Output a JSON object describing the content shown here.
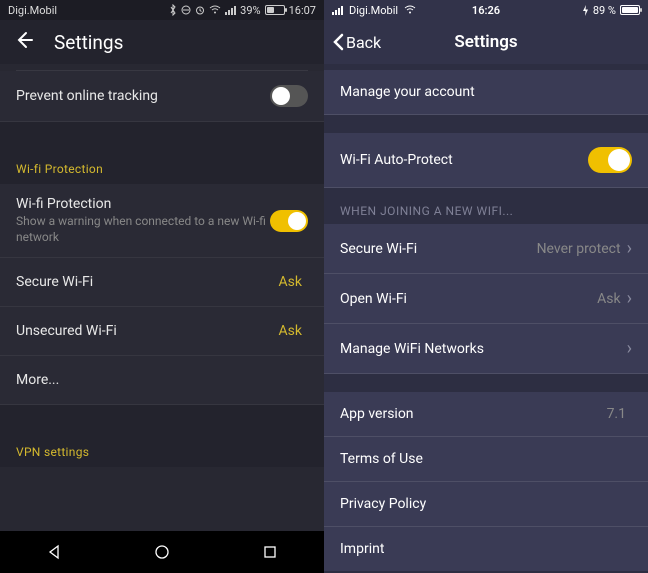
{
  "left": {
    "status": {
      "carrier": "Digi.Mobil",
      "battery": "39%",
      "time": "16:07"
    },
    "header": {
      "title": "Settings"
    },
    "rows": {
      "prevent_tracking": {
        "label": "Prevent online tracking",
        "toggled": false
      }
    },
    "wifi_section": {
      "header": "Wi-fi Protection",
      "protection": {
        "label": "Wi-fi Protection",
        "sub": "Show a warning when connected to a new Wi-fi network",
        "toggled": true
      },
      "secure": {
        "label": "Secure Wi-Fi",
        "value": "Ask"
      },
      "unsecured": {
        "label": "Unsecured Wi-Fi",
        "value": "Ask"
      },
      "more": {
        "label": "More..."
      }
    },
    "vpn_section": {
      "header": "VPN settings"
    }
  },
  "right": {
    "status": {
      "carrier": "Digi.Mobil",
      "time": "16:26",
      "battery": "89 %"
    },
    "header": {
      "back": "Back",
      "title": "Settings"
    },
    "manage": {
      "label": "Manage your account"
    },
    "auto_protect": {
      "label": "Wi-Fi Auto-Protect",
      "toggled": true
    },
    "join_section": {
      "header": "WHEN JOINING A NEW WIFI...",
      "secure": {
        "label": "Secure Wi-Fi",
        "value": "Never protect"
      },
      "open": {
        "label": "Open Wi-Fi",
        "value": "Ask"
      },
      "manage": {
        "label": "Manage WiFi Networks"
      }
    },
    "info": {
      "version": {
        "label": "App version",
        "value": "7.1"
      },
      "terms": {
        "label": "Terms of Use"
      },
      "privacy": {
        "label": "Privacy Policy"
      },
      "imprint": {
        "label": "Imprint"
      }
    }
  }
}
